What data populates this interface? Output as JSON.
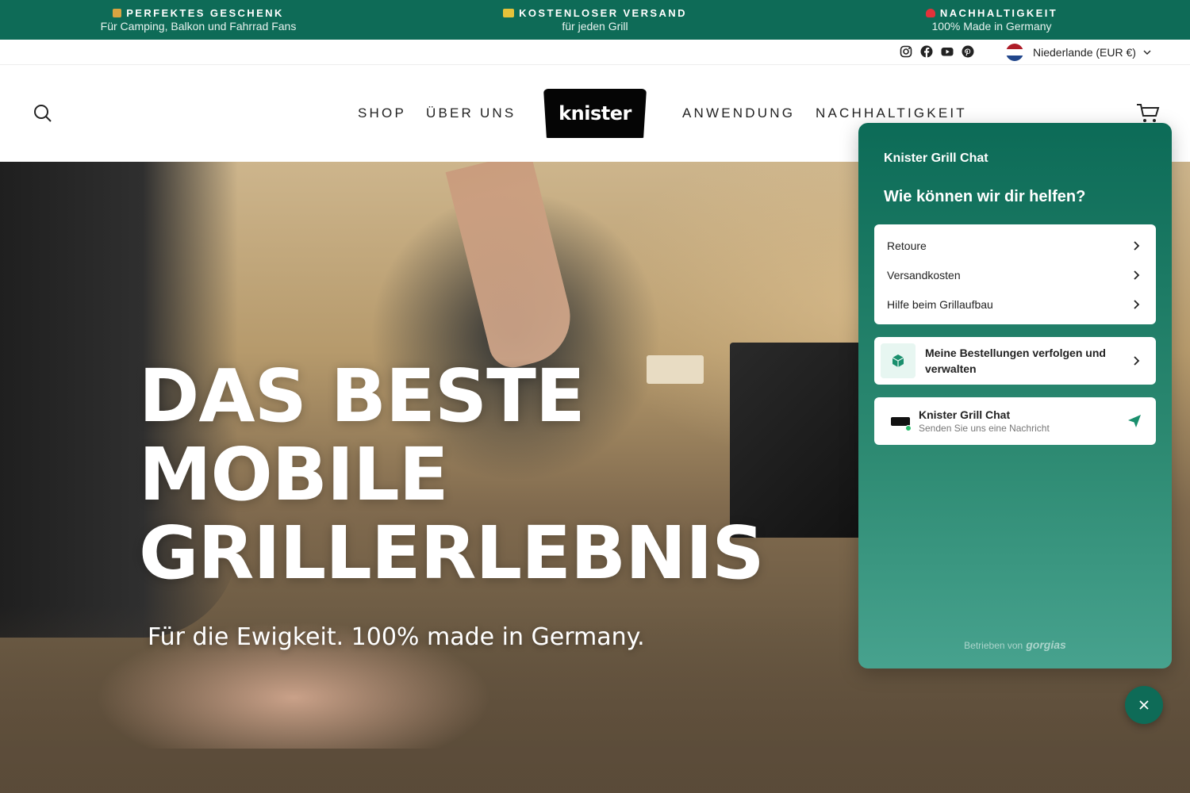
{
  "announcement": [
    {
      "title": "PERFEKTES GESCHENK",
      "subtitle": "Für Camping, Balkon und Fahrrad Fans",
      "icon": "gift-icon"
    },
    {
      "title": "KOSTENLOSER VERSAND",
      "subtitle": "für jeden Grill",
      "icon": "truck-icon"
    },
    {
      "title": "NACHHALTIGKEIT",
      "subtitle": "100% Made in Germany",
      "icon": "heart-icon"
    }
  ],
  "social": [
    "instagram-icon",
    "facebook-icon",
    "youtube-icon",
    "pinterest-icon"
  ],
  "locale": {
    "label": "Niederlande (EUR €)",
    "flag": "netherlands-flag"
  },
  "nav": {
    "shop": "SHOP",
    "about": "ÜBER UNS",
    "usage": "ANWENDUNG",
    "sustainability": "NACHHALTIGKEIT"
  },
  "logo": {
    "text": "knister"
  },
  "hero": {
    "headline_1": "DAS BESTE",
    "headline_2": "MOBILE",
    "headline_3": "GRILLERLEBNIS",
    "subline": "Für die Ewigkeit. 100% made in Germany."
  },
  "chat": {
    "brand": "Knister Grill Chat",
    "headline": "Wie können wir dir helfen?",
    "faq": [
      "Retoure",
      "Versandkosten",
      "Hilfe beim Grillaufbau"
    ],
    "orders_label": "Meine Bestellungen verfolgen und verwalten",
    "contact_name": "Knister Grill Chat",
    "contact_status": "Senden Sie uns eine Nachricht",
    "powered_label": "Betrieben von",
    "powered_brand": "gorgias"
  },
  "colors": {
    "brand_green": "#0e6b57",
    "accent_green": "#2dbd6e"
  }
}
